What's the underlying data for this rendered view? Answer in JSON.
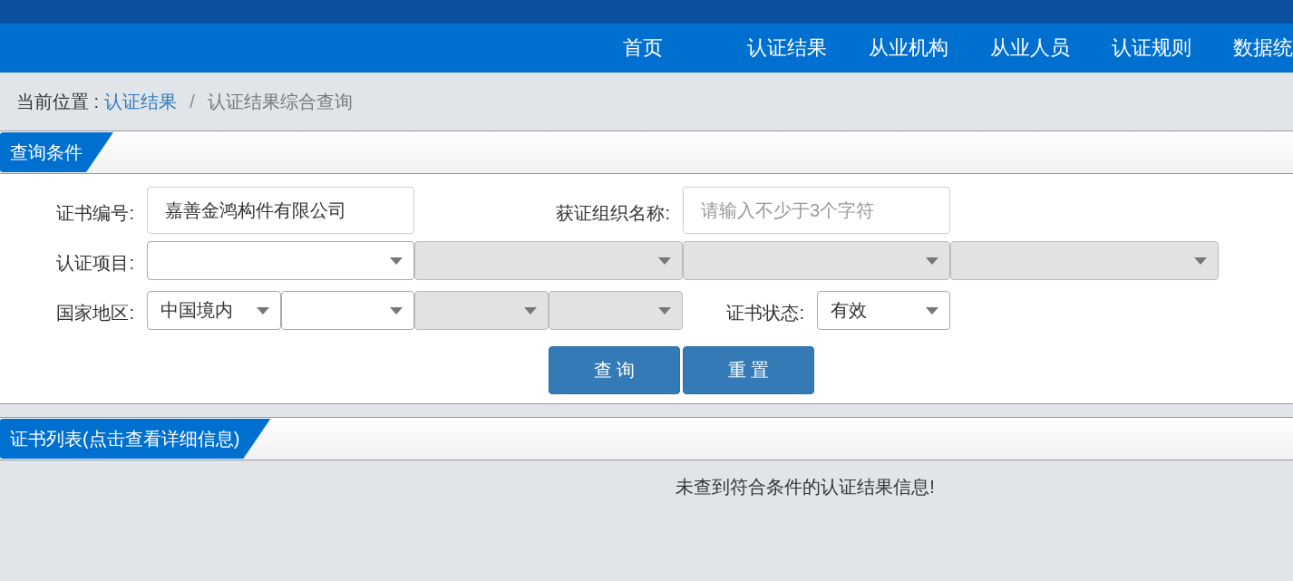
{
  "nav": [
    {
      "label": "首页"
    },
    {
      "label": "认证结果"
    },
    {
      "label": "从业机构"
    },
    {
      "label": "从业人员"
    },
    {
      "label": "认证规则"
    },
    {
      "label": "数据统"
    }
  ],
  "breadcrumb": {
    "prefix": "当前位置 :",
    "link": "认证结果",
    "separator": "/",
    "current": "认证结果综合查询"
  },
  "query_panel": {
    "title": "查询条件",
    "rows": [
      {
        "items": [
          {
            "kind": "label",
            "text": "证书编号:"
          },
          {
            "kind": "input",
            "value": "嘉善金鸿构件有限公司"
          },
          {
            "kind": "label",
            "text": "获证组织名称:"
          },
          {
            "kind": "input",
            "placeholder": "请输入不少于3个字符"
          }
        ]
      },
      {
        "items": [
          {
            "kind": "label",
            "text": "认证项目:"
          },
          {
            "kind": "select",
            "disabled": false
          },
          {
            "kind": "select",
            "disabled": true
          },
          {
            "kind": "select",
            "disabled": true
          },
          {
            "kind": "select",
            "disabled": true
          }
        ]
      },
      {
        "items": [
          {
            "kind": "label",
            "text": "国家地区:"
          },
          {
            "kind": "select",
            "value": "中国境内",
            "disabled": false
          },
          {
            "kind": "select",
            "disabled": false
          },
          {
            "kind": "select",
            "disabled": true
          },
          {
            "kind": "select",
            "disabled": true
          },
          {
            "kind": "label",
            "text": "证书状态:"
          },
          {
            "kind": "select",
            "value": "有效",
            "disabled": false
          }
        ]
      }
    ],
    "buttons": [
      "查 询",
      "重 置"
    ]
  },
  "list_panel": {
    "title": "证书列表(点击查看详细信息)",
    "empty_message": "未查到符合条件的认证结果信息!"
  }
}
